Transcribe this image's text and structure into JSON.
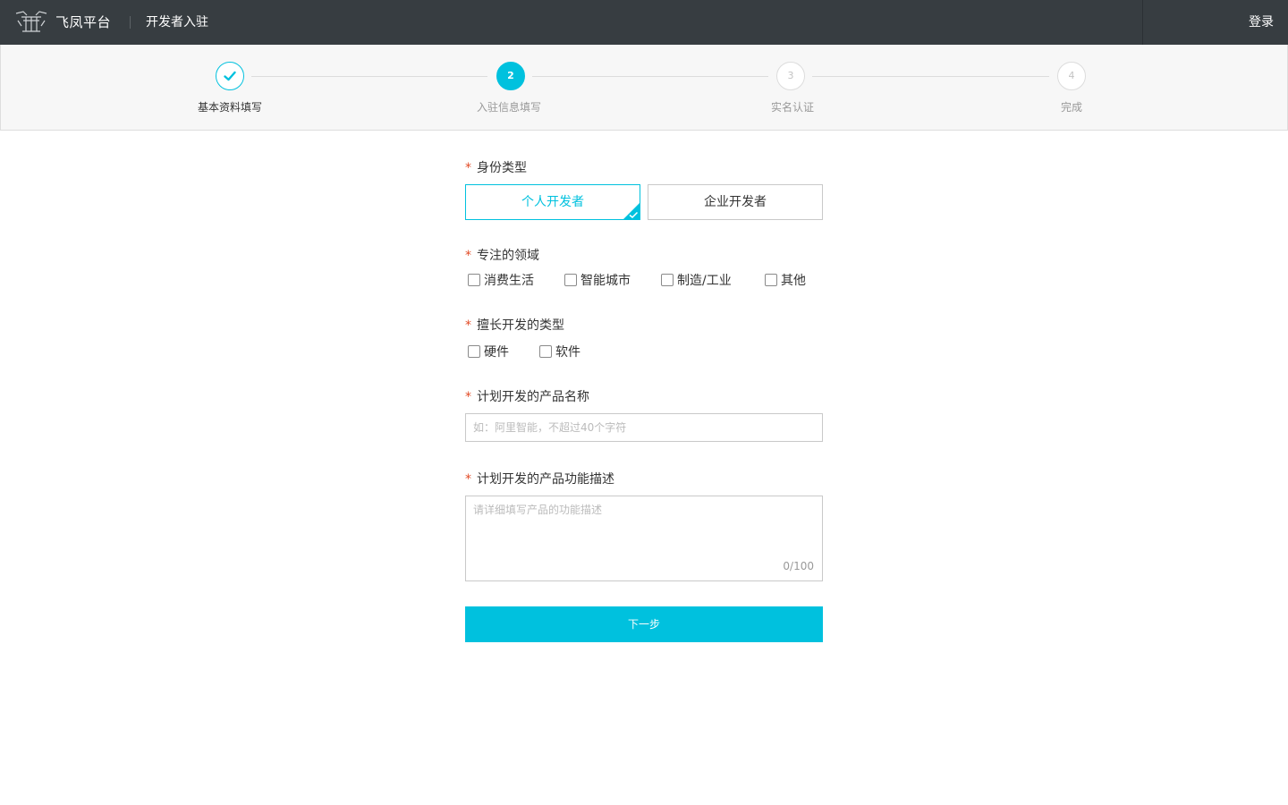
{
  "header": {
    "brand": "飞凤平台",
    "subtitle": "开发者入驻",
    "login_label": "登录"
  },
  "steps": [
    {
      "number": "1",
      "label": "基本资料填写",
      "state": "done"
    },
    {
      "number": "2",
      "label": "入驻信息填写",
      "state": "active"
    },
    {
      "number": "3",
      "label": "实名认证",
      "state": "pending"
    },
    {
      "number": "4",
      "label": "完成",
      "state": "pending"
    }
  ],
  "form": {
    "required_mark": "*",
    "identity": {
      "label": "身份类型",
      "options": [
        "个人开发者",
        "企业开发者"
      ],
      "selected": "个人开发者"
    },
    "domain": {
      "label": "专注的领域",
      "options": [
        "消费生活",
        "智能城市",
        "制造/工业",
        "其他"
      ]
    },
    "dev_type": {
      "label": "擅长开发的类型",
      "options": [
        "硬件",
        "软件"
      ]
    },
    "product_name": {
      "label": "计划开发的产品名称",
      "value": "",
      "placeholder": "如：阿里智能，不超过40个字符"
    },
    "product_desc": {
      "label": "计划开发的产品功能描述",
      "value": "",
      "placeholder": "请详细填写产品的功能描述",
      "counter": "0/100"
    },
    "next_label": "下一步"
  },
  "colors": {
    "accent": "#00c1de",
    "header_bg": "#373d41",
    "required": "#e24b26"
  }
}
